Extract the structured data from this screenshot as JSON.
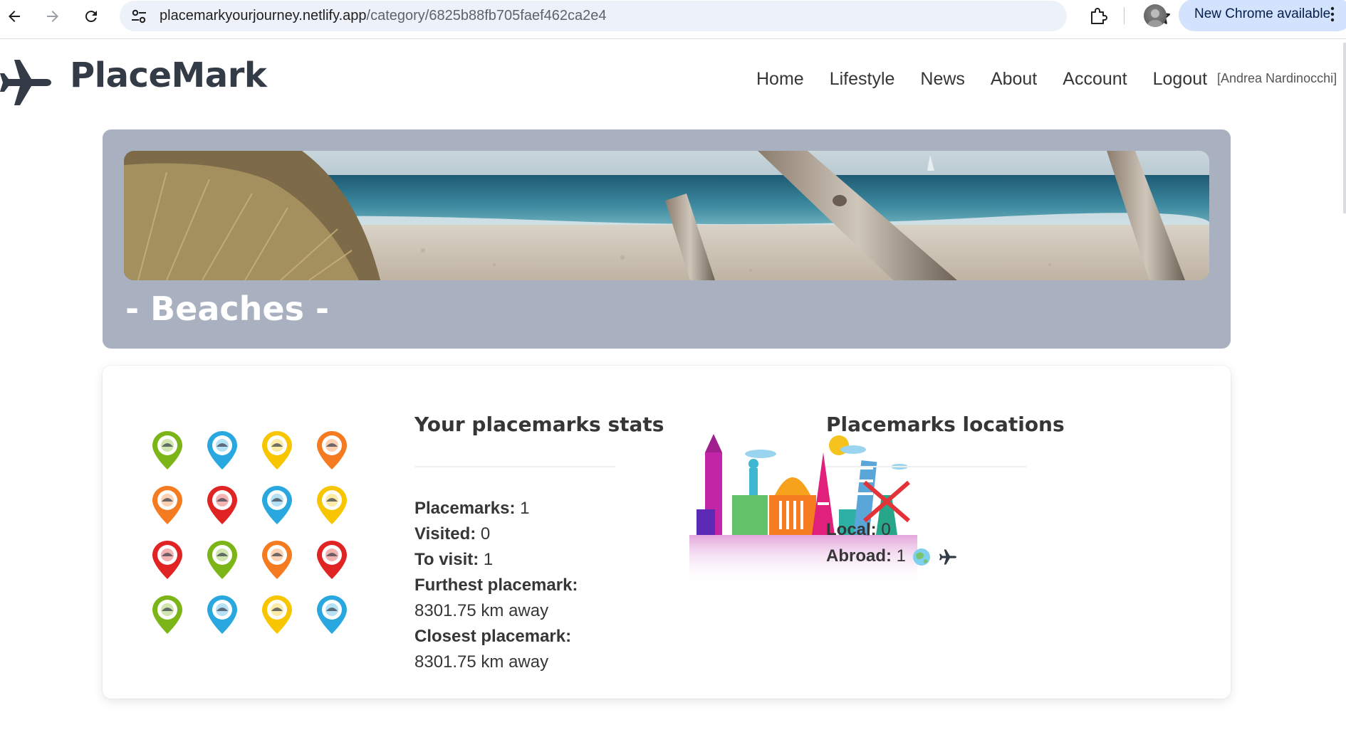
{
  "browser": {
    "url_host": "placemarkyourjourney.netlify.app",
    "url_path": "/category/6825b88fb705faef462ca2e4",
    "update_label": "New Chrome available",
    "icons": [
      "back-arrow-icon",
      "forward-arrow-icon",
      "reload-icon",
      "site-settings-icon",
      "bookmark-star-icon",
      "extensions-icon",
      "profile-avatar",
      "more-vert-icon"
    ]
  },
  "navbar": {
    "brand": "PlaceMark",
    "menu": [
      "Home",
      "Lifestyle",
      "News",
      "About",
      "Account",
      "Logout"
    ],
    "user": "[Andrea Nardinocchi]"
  },
  "hero": {
    "title": "- Beaches -"
  },
  "stats": {
    "title": "Your placemarks stats",
    "placemarks_label": "Placemarks:",
    "placemarks_value": "1",
    "visited_label": "Visited:",
    "visited_value": "0",
    "to_visit_label": "To visit:",
    "to_visit_value": "1",
    "furthest_label": "Furthest placemark:",
    "furthest_value": "8301.75 km away",
    "closest_label": "Closest placemark:",
    "closest_value": "8301.75 km away"
  },
  "locations": {
    "title": "Placemarks locations",
    "local_label": "Local:",
    "local_value": "0",
    "abroad_label": "Abroad:",
    "abroad_value": "1"
  },
  "pins": [
    {
      "color": "#7cb518",
      "icon": "boat"
    },
    {
      "color": "#29a8e0",
      "icon": "jet-ski"
    },
    {
      "color": "#f7c600",
      "icon": "umbrella"
    },
    {
      "color": "#f47b20",
      "icon": "swimmer"
    },
    {
      "color": "#f47b20",
      "icon": "volleyball"
    },
    {
      "color": "#e02424",
      "icon": "lifeguard"
    },
    {
      "color": "#29a8e0",
      "icon": "duck-float"
    },
    {
      "color": "#f7c600",
      "icon": "cocktail"
    },
    {
      "color": "#e02424",
      "icon": "surfer"
    },
    {
      "color": "#7cb518",
      "icon": "kitesurf"
    },
    {
      "color": "#f47b20",
      "icon": "raft"
    },
    {
      "color": "#e02424",
      "icon": "shirt"
    },
    {
      "color": "#7cb518",
      "icon": "deck-chair"
    },
    {
      "color": "#29a8e0",
      "icon": "boat-trip"
    },
    {
      "color": "#f7c600",
      "icon": "diver"
    },
    {
      "color": "#29a8e0",
      "icon": "hut"
    }
  ]
}
